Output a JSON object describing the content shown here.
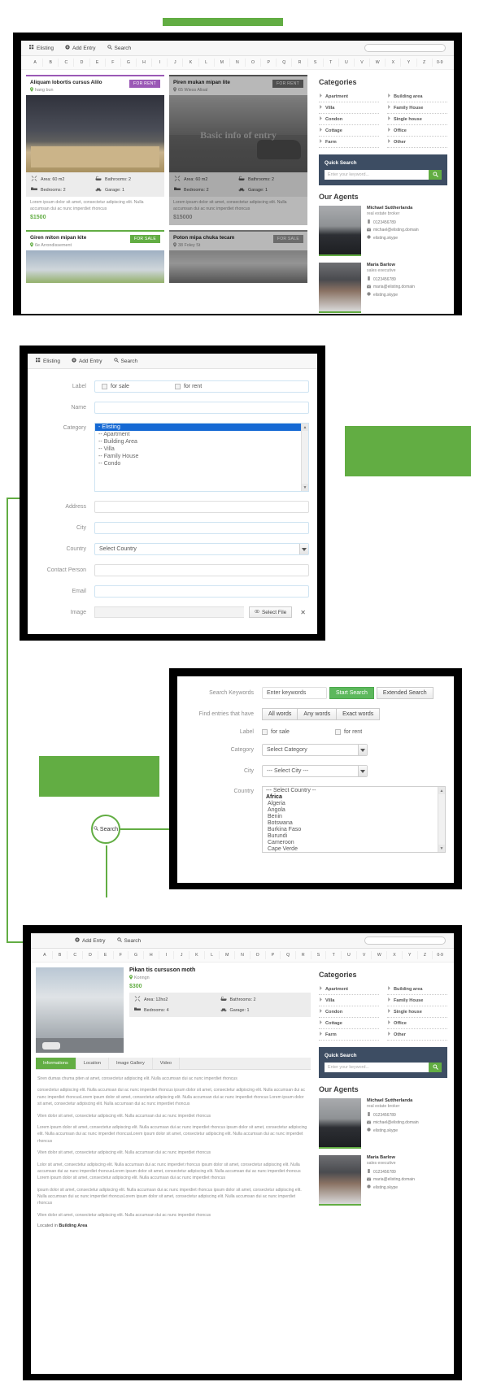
{
  "nav": {
    "brand": "Elisting",
    "add_entry": "Add Entry",
    "search": "Search"
  },
  "alphabet": [
    "A",
    "B",
    "C",
    "D",
    "E",
    "F",
    "G",
    "H",
    "I",
    "J",
    "K",
    "L",
    "M",
    "N",
    "O",
    "P",
    "Q",
    "R",
    "S",
    "T",
    "U",
    "V",
    "W",
    "X",
    "Y",
    "Z",
    "0-9"
  ],
  "listing": {
    "cards": [
      {
        "title": "Aliquam lobortis cursus Alilo",
        "location": "hang bun",
        "badge": "FOR RENT",
        "overlay": "",
        "area": "Area: 60 m2",
        "bathrooms": "Bathrooms: 2",
        "bedrooms": "Bedrooms: 2",
        "garage": "Garage: 1",
        "desc": "Lorem ipsum dolor sit amet, consectetur adipiscing elit. Nulla accumsan dui ac nunc imperdiet rhoncus",
        "price": "$1500"
      },
      {
        "title": "Piren mukan mipan lite",
        "location": "65 Wiess Alisal",
        "badge": "FOR RENT",
        "overlay": "Basic info of entry",
        "area": "Area: 60 m2",
        "bathrooms": "Bathrooms: 2",
        "bedrooms": "Bedrooms: 2",
        "garage": "Garage: 1",
        "desc": "Lorem ipsum dolor sit amet, consectetur adipiscing elit. Nulla accumsan dui ac nunc imperdiet rhoncus",
        "price": "$15000"
      },
      {
        "title": "Giren miton mipan kite",
        "location": "6e Arrondissement",
        "badge": "FOR SALE",
        "overlay": "",
        "area": "",
        "bathrooms": "",
        "bedrooms": "",
        "garage": "",
        "desc": "",
        "price": ""
      },
      {
        "title": "Poton mipa chuka tecam",
        "location": "38 Foley St",
        "badge": "FOR SALE",
        "overlay": "",
        "area": "",
        "bathrooms": "",
        "bedrooms": "",
        "garage": "",
        "desc": "",
        "price": ""
      }
    ]
  },
  "sidebar": {
    "categories_title": "Categories",
    "categories": [
      "Apartment",
      "Building area",
      "Villa",
      "Family House",
      "Condon",
      "Single house",
      "Cottage",
      "Office",
      "Farm",
      "Other"
    ],
    "quick_search": {
      "title": "Quick Search",
      "placeholder": "Enter your keyword..."
    },
    "agents_title": "Our Agents",
    "agents": [
      {
        "name": "Michael Suttherlanda",
        "role": "real estate broker",
        "phone": "0123456789",
        "email": "michael@elisting.domain",
        "skype": "elisting.skype"
      },
      {
        "name": "Maria Barlow",
        "role": "sales executive",
        "phone": "0123456789",
        "email": "maria@elisting.domain",
        "skype": "elisting.skype"
      }
    ]
  },
  "add_entry_form": {
    "labels": {
      "label": "Label",
      "name": "Name",
      "category": "Category",
      "address": "Address",
      "city": "City",
      "country": "Country",
      "contact_person": "Contact Person",
      "email": "Email",
      "image": "Image"
    },
    "label_options": [
      "for sale",
      "for rent"
    ],
    "category_options": [
      "- Elisting",
      "-- Apartment",
      "-- Building Area",
      "-- Villa",
      "-- Family House",
      "-- Condo"
    ],
    "category_selected": "- Elisting",
    "name_value": "",
    "address_value": "",
    "city_value": "",
    "country_value": "Select Country",
    "contact_person_value": "",
    "email_value": "",
    "select_file_label": "Select File",
    "clear_file_label": "✕"
  },
  "search_form": {
    "labels": {
      "keywords": "Search Keywords",
      "find_entries": "Find entries that have",
      "label": "Label",
      "category": "Category",
      "city": "City",
      "country": "Country"
    },
    "keywords_placeholder": "Enter keywords",
    "start_search": "Start Search",
    "extended_search": "Extended Search",
    "word_modes": [
      "All words",
      "Any words",
      "Exact words"
    ],
    "label_options": [
      "for sale",
      "for rent"
    ],
    "category_value": "Select Category",
    "city_value": "--- Select City ---",
    "country_options": [
      "--- Select Country --",
      "Africa",
      "Algeria",
      "Angola",
      "Benin",
      "Botswana",
      "Burkina Faso",
      "Burundi",
      "Cameroon",
      "Cape Verde"
    ]
  },
  "detail_view": {
    "title": "Pikan tis cursuson moth",
    "location": "Konngn",
    "price": "$300",
    "area": "Area: 12ho2",
    "bathrooms": "Bathrooms: 2",
    "bedrooms": "Bedrooms: 4",
    "garage": "Garage: 1",
    "tabs": [
      "Informations",
      "Location",
      "Image Gallery",
      "Video"
    ],
    "active_tab": "Informations",
    "paragraphs": [
      "Siren dumas chuma piten at amet, consectetur adipiscing elit. Nulla accumsan dui ac nunc imperdiet rhoncus",
      "consectetur adipiscing elit. Nulla accumsan dui ac nunc imperdiet rhoncus ipsum dolor sit amet, consectetur adipiscing elit. Nulla accumsan dui ac nunc imperdiet rhoncusLorem ipsum dolor sit amet, consectetur adipiscing elit. Nulla accumsan dui ac nunc imperdiet rhoncus Lorem ipsum dolor sit amet, consectetur adipiscing elit. Nulla accumsan dui ac nunc imperdiet rhoncus",
      "Viten dolor sit amet, consectetur adipiscing elit. Nulla accumsan dui ac nunc imperdiet rhoncus",
      "Lorem ipsum dolor sit amet, consectetur adipiscing elit. Nulla accumsan dui ac nunc imperdiet rhoncus ipsum dolor sit amet, consectetur adipiscing elit. Nulla accumsan dui ac nunc imperdiet rhoncusLorem ipsum dolor sit amet, consectetur adipiscing elit. Nulla accumsan dui ac nunc imperdiet rhoncus",
      "Viten dolor sit amet, consectetur adipiscing elit. Nulla accumsan dui ac nunc imperdiet rhoncus",
      "Lolor sit amet, consectetur adipiscing elit. Nulla accumsan dui ac nunc imperdiet rhoncus ipsum dolor sit amet, consectetur adipiscing elit. Nulla accumsan dui ac nunc imperdiet rhoncusLorem ipsum dolor sit amet, consectetur adipiscing elit. Nulla accumsan dui ac nunc imperdiet rhoncus Lorem ipsum dolor sit amet, consectetur adipiscing elit. Nulla accumsan dui ac nunc imperdiet rhoncus",
      "ipsum dolor sit amet, consectetur adipiscing elit. Nulla accumsan dui ac nunc imperdiet rhoncus ipsum dolor sit amet, consectetur adipiscing elit. Nulla accumsan dui ac nunc imperdiet rhoncusLorem ipsum dolor sit amet, consectetur adipiscing elit. Nulla accumsan dui ac nunc imperdiet rhoncus",
      "Viten dolor sit amet, consectetur adipiscing elit. Nulla accumsan dui ac nunc imperdiet rhoncus"
    ],
    "located_prefix": "Located in",
    "located_value": "Building Area"
  },
  "callouts": {
    "search": "Search",
    "add_entry": "Add Entry"
  },
  "colors": {
    "accent_green": "#62ad43",
    "rent_purple": "#9b59b6",
    "panel_navy": "#3d4d63"
  }
}
